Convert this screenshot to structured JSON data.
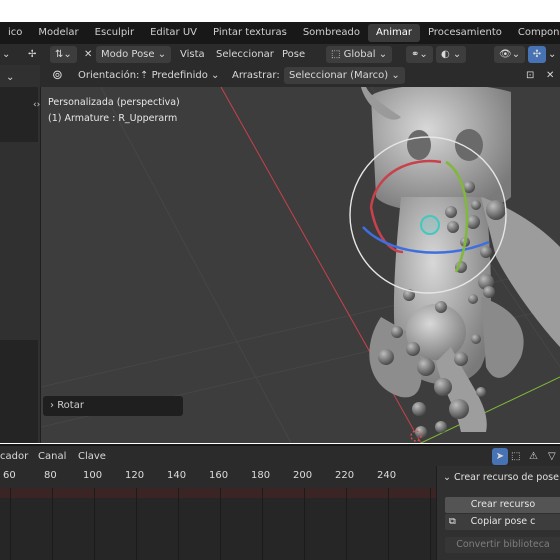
{
  "workspace_tabs": [
    {
      "label": "ico",
      "active": false
    },
    {
      "label": "Modelar",
      "active": false
    },
    {
      "label": "Esculpir",
      "active": false
    },
    {
      "label": "Editar UV",
      "active": false
    },
    {
      "label": "Pintar texturas",
      "active": false
    },
    {
      "label": "Sombreado",
      "active": false
    },
    {
      "label": "Animar",
      "active": true
    },
    {
      "label": "Procesamiento",
      "active": false
    },
    {
      "label": "Componer",
      "active": false
    }
  ],
  "header": {
    "mode": "Modo Pose",
    "menu_vista": "Vista",
    "menu_seleccionar": "Seleccionar",
    "menu_pose": "Pose",
    "transform_orientation": "Global"
  },
  "tool_header": {
    "orientation_label": "Orientación:",
    "orientation_value": "Predefinido",
    "drag_label": "Arrastrar:",
    "drag_value": "Seleccionar (Marco)"
  },
  "viewport": {
    "view_name": "Personalizada (perspectiva)",
    "active_object": "(1) Armature : R_Upperarm",
    "last_operator": "Rotar"
  },
  "dopesheet": {
    "menu_marcador": "cador",
    "menu_canal": "Canal",
    "menu_clave": "Clave",
    "frames": [
      "60",
      "80",
      "100",
      "120",
      "140",
      "160",
      "180",
      "200",
      "220",
      "240"
    ]
  },
  "pose_panel": {
    "title": "Crear recurso de pose",
    "create_button": "Crear recurso",
    "copy_button": "Copiar pose c",
    "convert_button": "Convertir biblioteca"
  },
  "colors": {
    "accent_blue": "#4772b3",
    "axis_red": "#c8414b",
    "axis_green": "#7fb83a",
    "gizmo_blue": "#3d6fe0"
  }
}
